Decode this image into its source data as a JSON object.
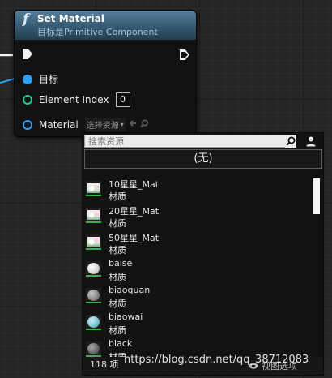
{
  "node": {
    "func_icon_glyph": "f",
    "title": "Set Material",
    "subtitle": "目标是Primitive Component",
    "header_color": "#3b6078",
    "pins": {
      "target_label": "目标",
      "element_index_label": "Element Index",
      "element_index_value": "0",
      "material_label": "Material",
      "asset_select_label": "选择资源",
      "asset_select_caret": "▾"
    }
  },
  "popup": {
    "search_placeholder": "搜索资源",
    "none_label": "(无)",
    "items": [
      {
        "name": "10星星_Mat",
        "type": "材质",
        "thumb": "stars",
        "color": "#e9c9d6"
      },
      {
        "name": "20星星_Mat",
        "type": "材质",
        "thumb": "stars",
        "color": "#e9c9d6"
      },
      {
        "name": "50星星_Mat",
        "type": "材质",
        "thumb": "stars",
        "color": "#e9c9d6"
      },
      {
        "name": "baise",
        "type": "材质",
        "thumb": "orb",
        "color": "#e8e8e8"
      },
      {
        "name": "biaoquan",
        "type": "材质",
        "thumb": "orb",
        "color": "#8a8a8a"
      },
      {
        "name": "biaowai",
        "type": "材质",
        "thumb": "orb",
        "color": "#7fc6d6"
      },
      {
        "name": "black",
        "type": "材质",
        "thumb": "orb",
        "color": "#6a6a6a"
      }
    ],
    "count_label": "118 项",
    "view_options_label": "视图选项",
    "scroll_position": 0
  },
  "watermark": "https://blog.csdn.net/qq_38712083",
  "icons": {
    "search": "search-icon",
    "user": "user-icon",
    "use_selected": "arrow-left-icon",
    "browse": "magnifier-icon",
    "view": "eye-icon"
  },
  "colors": {
    "exec_pin": "#f2f2f2",
    "object_pin": "#2f9ef3",
    "int_pin": "#21c8a0",
    "wire": "#2f9ef3"
  }
}
